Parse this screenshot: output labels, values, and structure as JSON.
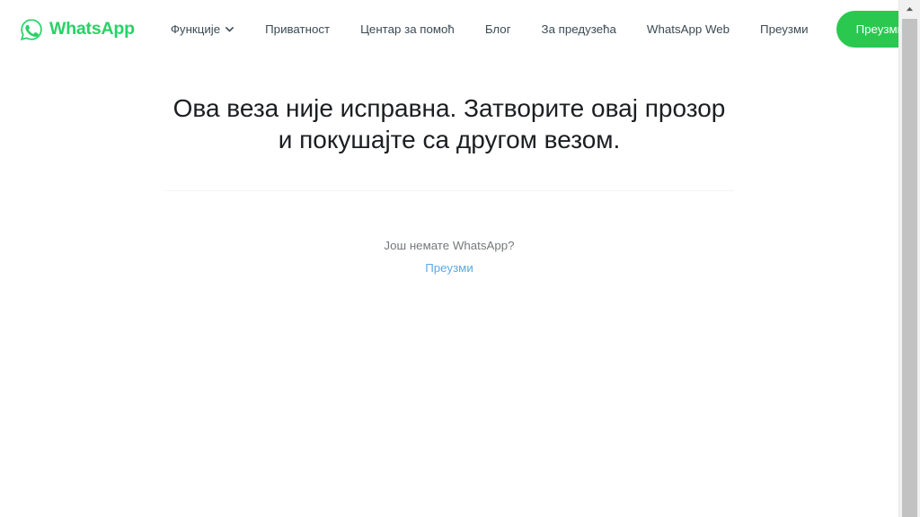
{
  "brand": {
    "name": "WhatsApp",
    "logo_icon": "whatsapp-logo-icon",
    "accent_color": "#25D366"
  },
  "header": {
    "nav_items": [
      {
        "label": "Функције",
        "has_dropdown": true,
        "icon": "chevron-down-icon"
      },
      {
        "label": "Приватност",
        "has_dropdown": false
      },
      {
        "label": "Центар за помоћ",
        "has_dropdown": false
      },
      {
        "label": "Блог",
        "has_dropdown": false
      },
      {
        "label": "За предузећа",
        "has_dropdown": false
      },
      {
        "label": "WhatsApp Web",
        "has_dropdown": false
      },
      {
        "label": "Преузми",
        "has_dropdown": false
      }
    ],
    "cta": {
      "label": "Преузми",
      "icon": "download-icon",
      "background_color": "#2BC84F",
      "text_color": "#ffffff"
    }
  },
  "main": {
    "heading": "Ова веза није исправна. Затворите овај прозор и покушајте са другом везом.",
    "divider_visible": true,
    "sub_question": "Још немате WhatsApp?",
    "sub_link": "Преузми",
    "sub_link_color": "#5DA9E9",
    "sub_text_color": "#75797c"
  },
  "scrollbar": {
    "up_arrow_icon": "scroll-up-arrow-icon",
    "thumb_color": "#c2c2c2",
    "track_color": "#f1f1f1"
  }
}
